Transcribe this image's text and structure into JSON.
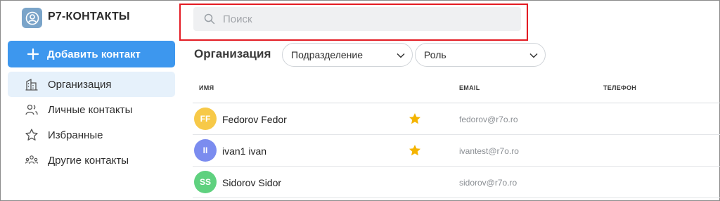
{
  "app": {
    "title": "Р7-КОНТАКТЫ",
    "logo_color": "#7aa4c9"
  },
  "sidebar": {
    "add_button_label": "Добавить контакт",
    "accent_color": "#3d97ee",
    "items": [
      {
        "label": "Организация",
        "icon": "building-icon",
        "active": true
      },
      {
        "label": "Личные контакты",
        "icon": "people-icon",
        "active": false
      },
      {
        "label": "Избранные",
        "icon": "star-outline-icon",
        "active": false
      },
      {
        "label": "Другие контакты",
        "icon": "group-icon",
        "active": false
      }
    ]
  },
  "search": {
    "placeholder": "Поиск",
    "value": "",
    "highlight_color": "#e31b23"
  },
  "filters": {
    "section_title": "Организация",
    "subdivision": "Подразделение",
    "role": "Роль"
  },
  "table": {
    "columns": [
      "ИМЯ",
      "EMAIL",
      "ТЕЛЕФОН"
    ],
    "rows": [
      {
        "initials": "FF",
        "name": "Fedorov Fedor",
        "email": "fedorov@r7o.ro",
        "favorite": true,
        "avatar_color": "#f7c948"
      },
      {
        "initials": "II",
        "name": "ivan1 ivan",
        "email": "ivantest@r7o.ro",
        "favorite": true,
        "avatar_color": "#7b8cef"
      },
      {
        "initials": "SS",
        "name": "Sidorov Sidor",
        "email": "sidorov@r7o.ro",
        "favorite": false,
        "avatar_color": "#5fd17f"
      }
    ]
  }
}
